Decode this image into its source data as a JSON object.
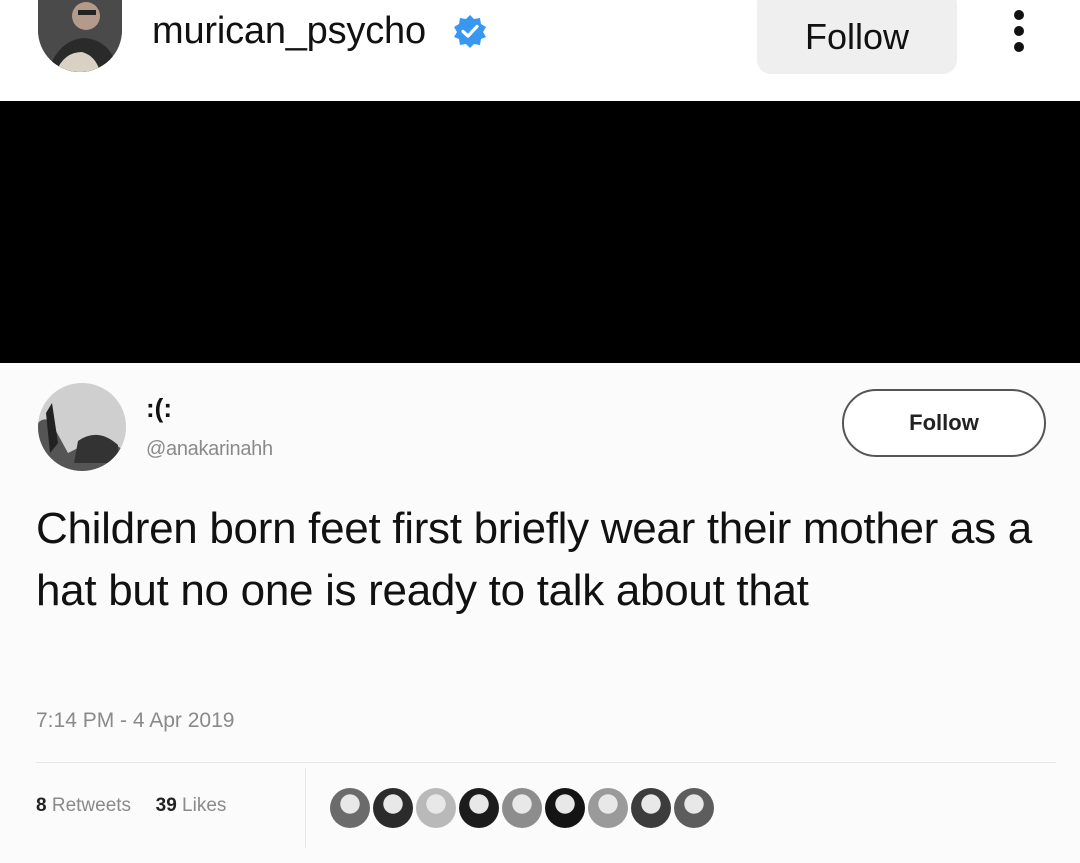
{
  "header": {
    "username": "murican_psycho",
    "verified": true,
    "follow_label": "Follow",
    "more_icon": "more-vertical-icon"
  },
  "tweet": {
    "display_name": ":(:",
    "handle": "@anakarinahh",
    "follow_label": "Follow",
    "text": "Children born feet first briefly wear their mother as a hat but no one is ready to talk about that",
    "timestamp": "7:14 PM - 4 Apr 2019",
    "retweets_count": "8",
    "retweets_label": "Retweets",
    "likes_count": "39",
    "likes_label": "Likes",
    "liker_colors": [
      "#6b6b6b",
      "#2b2b2b",
      "#b9b9b9",
      "#1c1c1c",
      "#8d8d8d",
      "#141414",
      "#9a9a9a",
      "#3c3c3c",
      "#5d5d5d"
    ]
  },
  "colors": {
    "verified_blue": "#3897f0",
    "band": "#000000"
  }
}
